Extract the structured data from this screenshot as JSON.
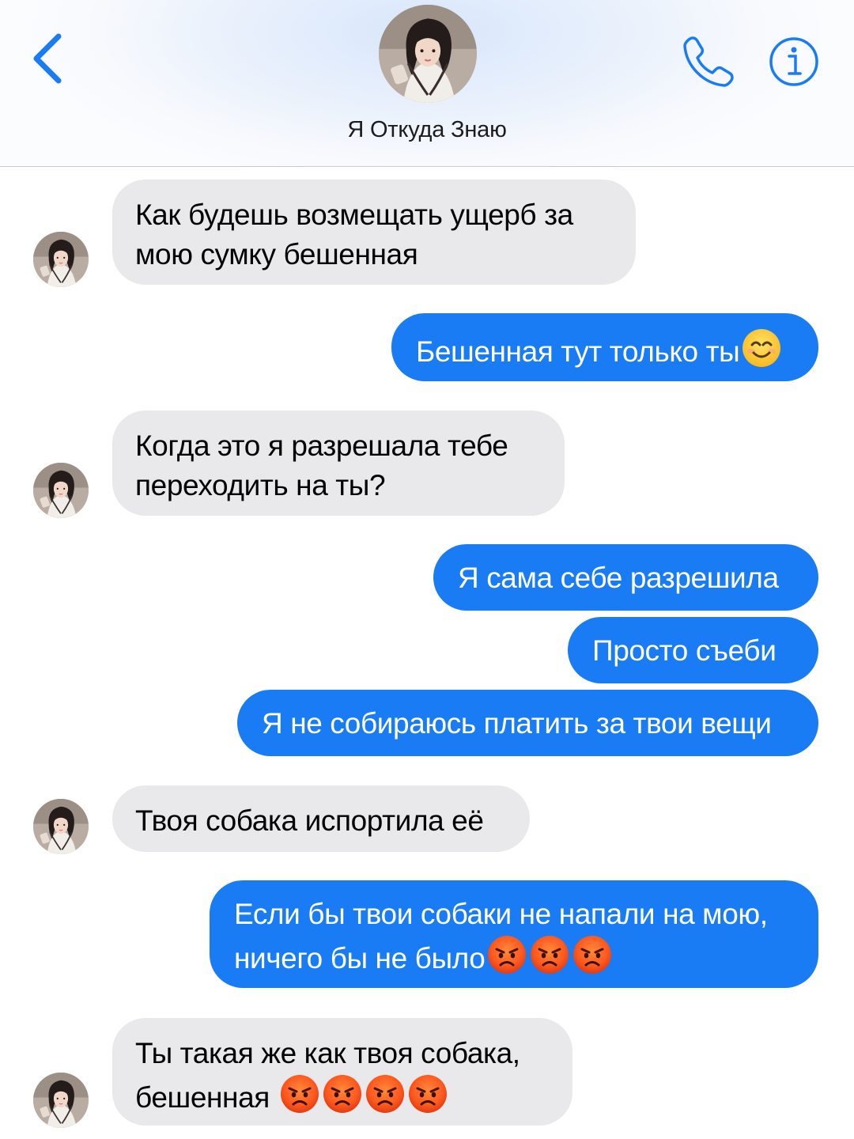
{
  "header": {
    "contact_name": "Я Откуда Знаю",
    "back_icon": "chevron-left-icon",
    "call_icon": "phone-icon",
    "info_icon": "info-icon",
    "accent_color": "#1a7cf5"
  },
  "messages": [
    {
      "direction": "incoming",
      "lines": [
        "Как будешь возмещать ущерб за",
        "мою сумку бешенная"
      ]
    },
    {
      "direction": "outgoing",
      "lines": [
        "Бешенная тут только ты"
      ],
      "emoji": [
        "smiling-face-icon"
      ]
    },
    {
      "direction": "incoming",
      "lines": [
        "Когда это я разрешала тебе",
        "переходить на ты?"
      ]
    },
    {
      "direction": "outgoing",
      "lines": [
        "Я сама себе разрешила"
      ]
    },
    {
      "direction": "outgoing",
      "lines": [
        "Просто съеби"
      ]
    },
    {
      "direction": "outgoing",
      "lines": [
        "Я не собираюсь платить за твои вещи"
      ]
    },
    {
      "direction": "incoming",
      "lines": [
        "Твоя собака испортила её"
      ]
    },
    {
      "direction": "outgoing",
      "lines": [
        "Если бы твои собаки не напали на мою,",
        "ничего бы не было"
      ],
      "emoji": [
        "angry-face-icon",
        "angry-face-icon",
        "angry-face-icon"
      ]
    },
    {
      "direction": "incoming",
      "lines": [
        "Ты такая же как твоя собака,",
        "бешенная "
      ],
      "emoji": [
        "angry-face-icon",
        "angry-face-icon",
        "angry-face-icon",
        "angry-face-icon"
      ]
    }
  ],
  "colors": {
    "incoming_bubble": "#e9e9eb",
    "outgoing_bubble": "#1a7cf5",
    "outgoing_text": "#ffffff",
    "incoming_text": "#000000"
  }
}
